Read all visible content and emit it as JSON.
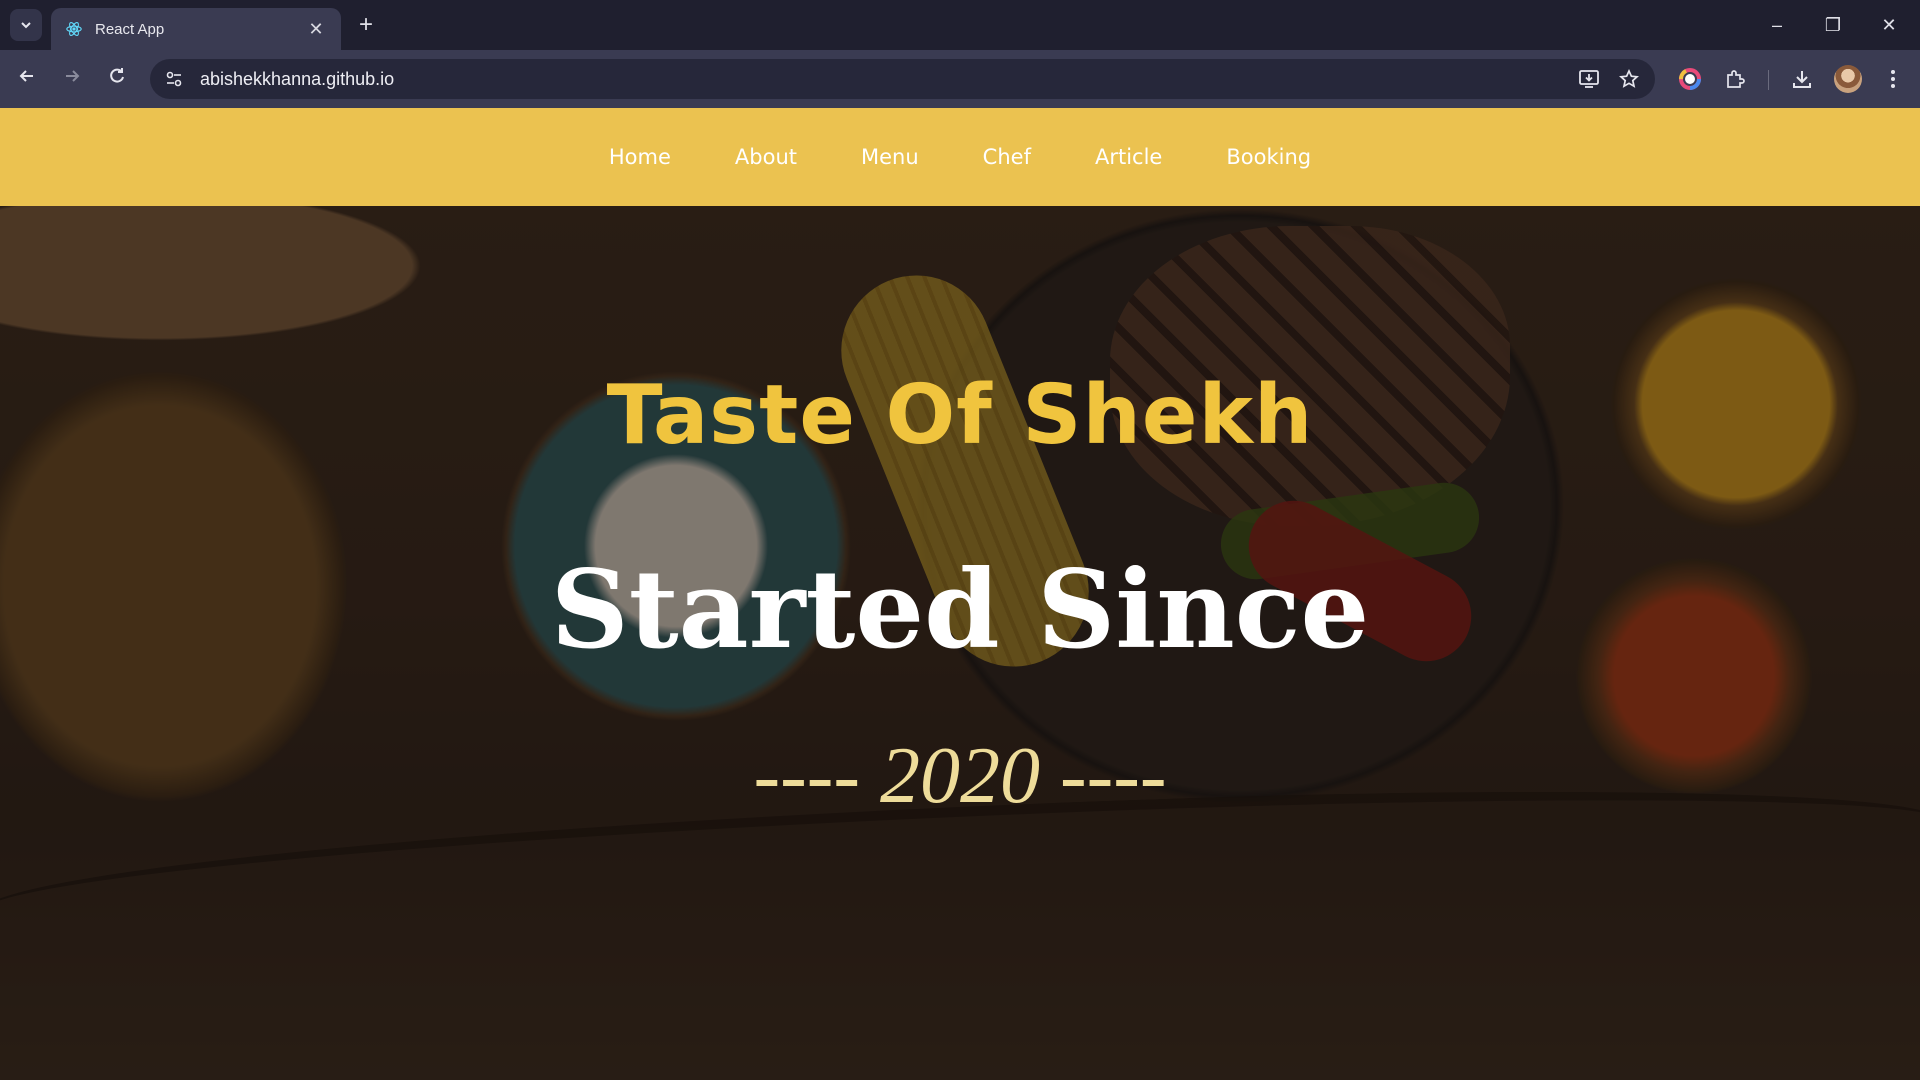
{
  "browser": {
    "tab": {
      "title": "React App"
    },
    "new_tab_label": "+",
    "window_controls": {
      "minimize": "–",
      "restore": "❐",
      "close": "✕"
    },
    "url": "abishekkhanna.github.io"
  },
  "site": {
    "nav": {
      "items": [
        {
          "label": "Home"
        },
        {
          "label": "About"
        },
        {
          "label": "Menu"
        },
        {
          "label": "Chef"
        },
        {
          "label": "Article"
        },
        {
          "label": "Booking"
        }
      ]
    },
    "hero": {
      "title": "Taste Of Shekh",
      "subtitle": "Started Since",
      "year_line": "---- 2020 ----"
    }
  },
  "colors": {
    "navbar": "#ebc250",
    "hero_title": "#f0c43e",
    "hero_subtitle": "#ffffff",
    "hero_year": "#eedc9a"
  }
}
